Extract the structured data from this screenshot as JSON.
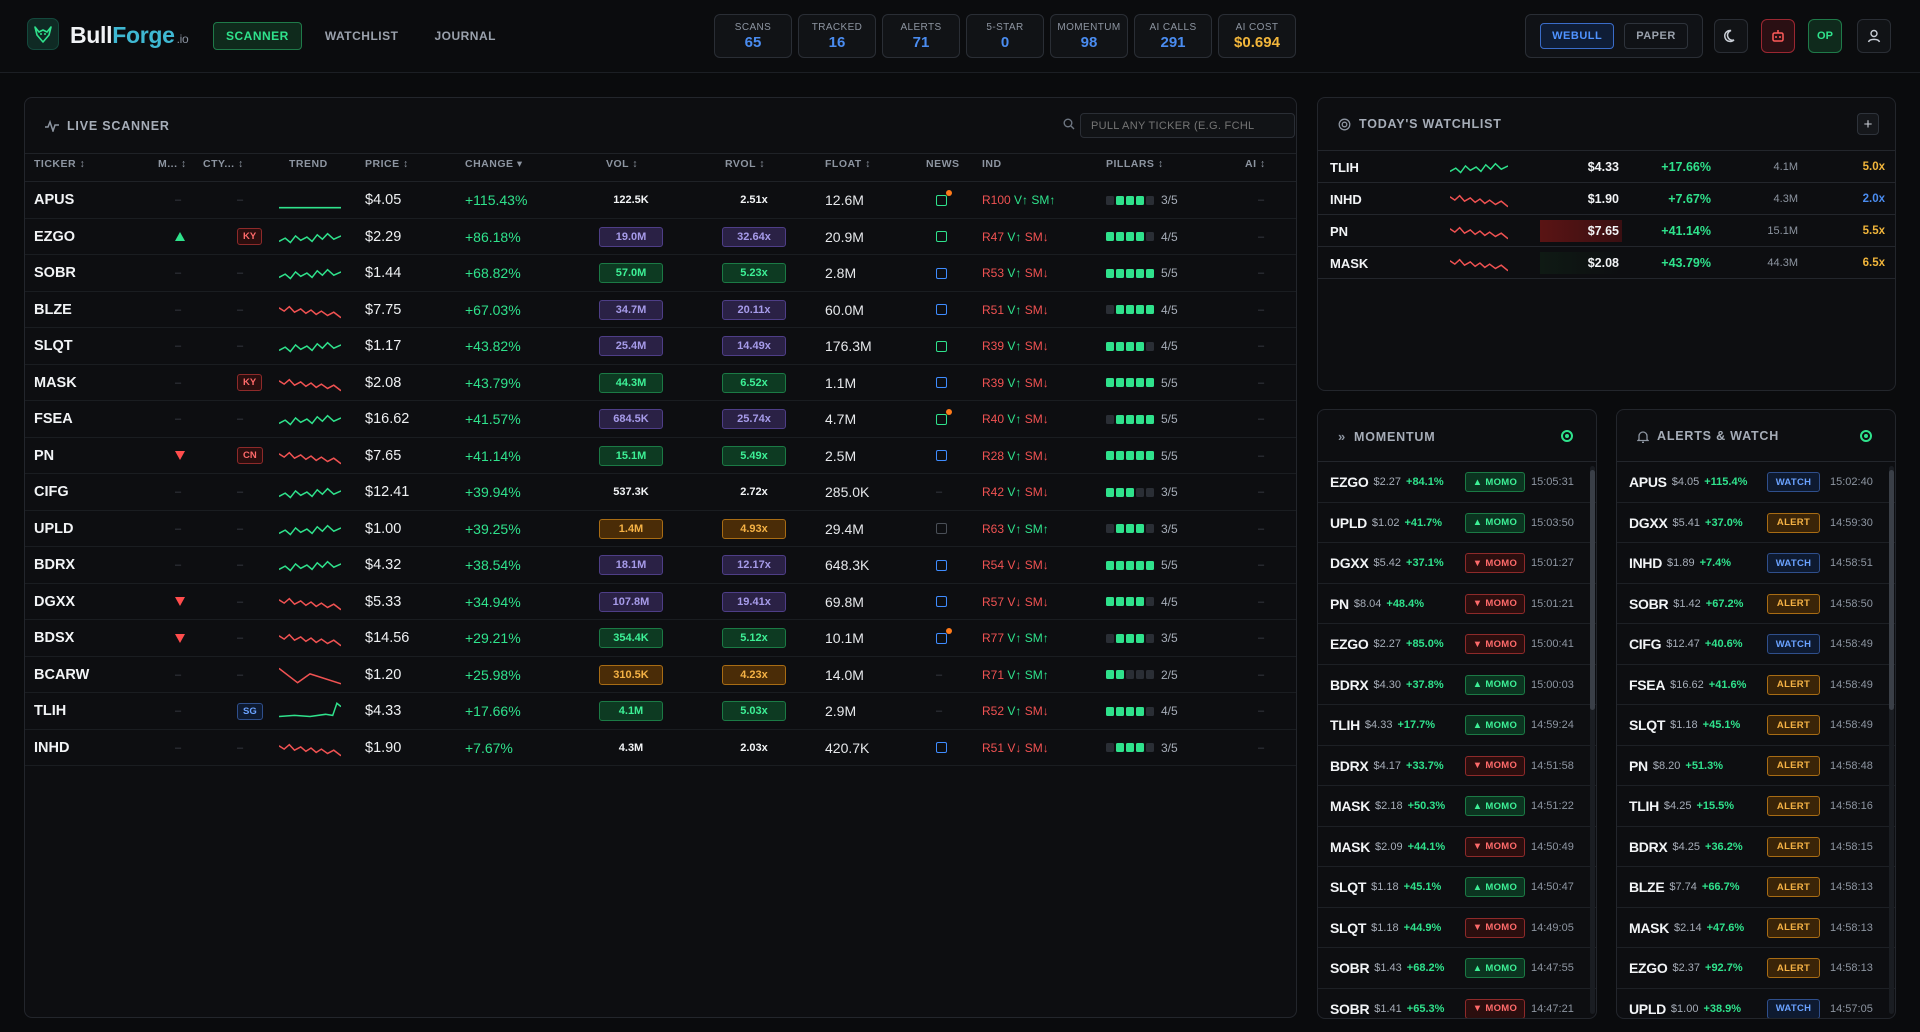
{
  "brand": {
    "name_a": "Bull",
    "name_b": "Forge",
    "name_c": ".io"
  },
  "nav": [
    {
      "label": "SCANNER",
      "active": true
    },
    {
      "label": "WATCHLIST",
      "active": false
    },
    {
      "label": "JOURNAL",
      "active": false
    }
  ],
  "stats": [
    {
      "label": "SCANS",
      "value": "65"
    },
    {
      "label": "TRACKED",
      "value": "16"
    },
    {
      "label": "ALERTS",
      "value": "71"
    },
    {
      "label": "5-STAR",
      "value": "0"
    },
    {
      "label": "MOMENTUM",
      "value": "98"
    },
    {
      "label": "AI CALLS",
      "value": "291"
    },
    {
      "label": "AI COST",
      "value": "$0.694"
    }
  ],
  "broker": {
    "webull": "WEBULL",
    "paper": "PAPER"
  },
  "header_icons": {
    "op_label": "OP"
  },
  "colors": {
    "green": "#2fe28c",
    "red": "#f05252",
    "blue": "#4a8cf0",
    "gold": "#f2b63b",
    "purple": "#a69be9",
    "orange": "#f5b245"
  },
  "scanner": {
    "title": "LIVE SCANNER",
    "search_placeholder": "PULL ANY TICKER (E.G. FCHL",
    "columns": {
      "ticker": "TICKER ↕",
      "m": "M... ↕",
      "cty": "CTY... ↕",
      "trend": "TREND",
      "price": "PRICE ↕",
      "change": "CHANGE ▾",
      "vol": "VOL ↕",
      "rvol": "RVOL ↕",
      "float": "FLOAT ↕",
      "news": "NEWS",
      "ind": "IND",
      "pillars": "PILLARS ↕",
      "ai": "AI ↕"
    },
    "rows": [
      {
        "ticker": "APUS",
        "m": "",
        "cty": "",
        "price": "$4.05",
        "change": "+115.43%",
        "vol": "122.5K",
        "vol_style": "plain",
        "rvol": "2.51x",
        "rvol_style": "plain",
        "float": "12.6M",
        "news": "green-hot",
        "ind_r": "R100",
        "ind_v": "V↑",
        "ind_sm": "SM↑",
        "pillars": 3,
        "trend_dir": "flat"
      },
      {
        "ticker": "EZGO",
        "m": "up",
        "cty": "KY",
        "price": "$2.29",
        "change": "+86.18%",
        "vol": "19.0M",
        "vol_style": "purple",
        "rvol": "32.64x",
        "rvol_style": "purple",
        "float": "20.9M",
        "news": "green",
        "ind_r": "R47",
        "ind_v": "V↑",
        "ind_sm": "SM↓",
        "pillars": 4,
        "trend_dir": "green"
      },
      {
        "ticker": "SOBR",
        "m": "",
        "cty": "",
        "price": "$1.44",
        "change": "+68.82%",
        "vol": "57.0M",
        "vol_style": "green",
        "rvol": "5.23x",
        "rvol_style": "green",
        "float": "2.8M",
        "news": "blue",
        "ind_r": "R53",
        "ind_v": "V↑",
        "ind_sm": "SM↓",
        "pillars": 5,
        "trend_dir": "green"
      },
      {
        "ticker": "BLZE",
        "m": "",
        "cty": "",
        "price": "$7.75",
        "change": "+67.03%",
        "vol": "34.7M",
        "vol_style": "purple",
        "rvol": "20.11x",
        "rvol_style": "purple",
        "float": "60.0M",
        "news": "blue",
        "ind_r": "R51",
        "ind_v": "V↑",
        "ind_sm": "SM↓",
        "pillars": 4,
        "trend_dir": "red"
      },
      {
        "ticker": "SLQT",
        "m": "",
        "cty": "",
        "price": "$1.17",
        "change": "+43.82%",
        "vol": "25.4M",
        "vol_style": "purple",
        "rvol": "14.49x",
        "rvol_style": "purple",
        "float": "176.3M",
        "news": "green",
        "ind_r": "R39",
        "ind_v": "V↑",
        "ind_sm": "SM↓",
        "pillars": 4,
        "trend_dir": "green"
      },
      {
        "ticker": "MASK",
        "m": "",
        "cty": "KY",
        "price": "$2.08",
        "change": "+43.79%",
        "vol": "44.3M",
        "vol_style": "green",
        "rvol": "6.52x",
        "rvol_style": "green",
        "float": "1.1M",
        "news": "blue",
        "ind_r": "R39",
        "ind_v": "V↑",
        "ind_sm": "SM↓",
        "pillars": 5,
        "trend_dir": "red"
      },
      {
        "ticker": "FSEA",
        "m": "",
        "cty": "",
        "price": "$16.62",
        "change": "+41.57%",
        "vol": "684.5K",
        "vol_style": "purple",
        "rvol": "25.74x",
        "rvol_style": "purple",
        "float": "4.7M",
        "news": "green-hot",
        "ind_r": "R40",
        "ind_v": "V↑",
        "ind_sm": "SM↓",
        "pillars": 5,
        "trend_dir": "green"
      },
      {
        "ticker": "PN",
        "m": "down",
        "cty": "CN",
        "price": "$7.65",
        "change": "+41.14%",
        "vol": "15.1M",
        "vol_style": "green",
        "rvol": "5.49x",
        "rvol_style": "green",
        "float": "2.5M",
        "news": "blue",
        "ind_r": "R28",
        "ind_v": "V↑",
        "ind_sm": "SM↓",
        "pillars": 5,
        "trend_dir": "red"
      },
      {
        "ticker": "CIFG",
        "m": "",
        "cty": "",
        "price": "$12.41",
        "change": "+39.94%",
        "vol": "537.3K",
        "vol_style": "plain",
        "rvol": "2.72x",
        "rvol_style": "plain",
        "float": "285.0K",
        "news": "none",
        "ind_r": "R42",
        "ind_v": "V↑",
        "ind_sm": "SM↓",
        "pillars": 3,
        "trend_dir": "green"
      },
      {
        "ticker": "UPLD",
        "m": "",
        "cty": "",
        "price": "$1.00",
        "change": "+39.25%",
        "vol": "1.4M",
        "vol_style": "orange",
        "rvol": "4.93x",
        "rvol_style": "orange",
        "float": "29.4M",
        "news": "grey",
        "ind_r": "R63",
        "ind_v": "V↑",
        "ind_sm": "SM↑",
        "pillars": 3,
        "trend_dir": "green"
      },
      {
        "ticker": "BDRX",
        "m": "",
        "cty": "",
        "price": "$4.32",
        "change": "+38.54%",
        "vol": "18.1M",
        "vol_style": "purple",
        "rvol": "12.17x",
        "rvol_style": "purple",
        "float": "648.3K",
        "news": "blue",
        "ind_r": "R54",
        "ind_v": "V↓",
        "ind_sm": "SM↓",
        "pillars": 5,
        "trend_dir": "green"
      },
      {
        "ticker": "DGXX",
        "m": "down",
        "cty": "",
        "price": "$5.33",
        "change": "+34.94%",
        "vol": "107.8M",
        "vol_style": "purple",
        "rvol": "19.41x",
        "rvol_style": "purple",
        "float": "69.8M",
        "news": "blue",
        "ind_r": "R57",
        "ind_v": "V↓",
        "ind_sm": "SM↓",
        "pillars": 4,
        "trend_dir": "red"
      },
      {
        "ticker": "BDSX",
        "m": "down",
        "cty": "",
        "price": "$14.56",
        "change": "+29.21%",
        "vol": "354.4K",
        "vol_style": "green",
        "rvol": "5.12x",
        "rvol_style": "green",
        "float": "10.1M",
        "news": "blue-hot",
        "ind_r": "R77",
        "ind_v": "V↑",
        "ind_sm": "SM↑",
        "pillars": 3,
        "trend_dir": "red"
      },
      {
        "ticker": "BCARW",
        "m": "",
        "cty": "",
        "price": "$1.20",
        "change": "+25.98%",
        "vol": "310.5K",
        "vol_style": "orange",
        "rvol": "4.23x",
        "rvol_style": "orange",
        "float": "14.0M",
        "news": "none",
        "ind_r": "R71",
        "ind_v": "V↑",
        "ind_sm": "SM↑",
        "pillars": 2,
        "trend_dir": "red-v"
      },
      {
        "ticker": "TLIH",
        "m": "",
        "cty": "SG",
        "price": "$4.33",
        "change": "+17.66%",
        "vol": "4.1M",
        "vol_style": "green",
        "rvol": "5.03x",
        "rvol_style": "green",
        "float": "2.9M",
        "news": "none",
        "ind_r": "R52",
        "ind_v": "V↑",
        "ind_sm": "SM↓",
        "pillars": 4,
        "trend_dir": "green-spike"
      },
      {
        "ticker": "INHD",
        "m": "",
        "cty": "",
        "price": "$1.90",
        "change": "+7.67%",
        "vol": "4.3M",
        "vol_style": "plain",
        "rvol": "2.03x",
        "rvol_style": "plain",
        "float": "420.7K",
        "news": "blue",
        "ind_r": "R51",
        "ind_v": "V↓",
        "ind_sm": "SM↓",
        "pillars": 3,
        "trend_dir": "red"
      }
    ]
  },
  "watchlist": {
    "title": "TODAY'S WATCHLIST",
    "add_label": "+",
    "rows": [
      {
        "ticker": "TLIH",
        "price": "$4.33",
        "change": "+17.66%",
        "vol": "4.1M",
        "rvol": "5.0x",
        "rvol_color": "#f2b63b",
        "spark": "green"
      },
      {
        "ticker": "INHD",
        "price": "$1.90",
        "change": "+7.67%",
        "vol": "4.3M",
        "rvol": "2.0x",
        "rvol_color": "#4a8cf0",
        "spark": "red"
      },
      {
        "ticker": "PN",
        "price": "$7.65",
        "change": "+41.14%",
        "vol": "15.1M",
        "rvol": "5.5x",
        "rvol_color": "#f2b63b",
        "spark": "red"
      },
      {
        "ticker": "MASK",
        "price": "$2.08",
        "change": "+43.79%",
        "vol": "44.3M",
        "rvol": "6.5x",
        "rvol_color": "#f2b63b",
        "spark": "red"
      }
    ]
  },
  "momentum": {
    "title": "MOMENTUM",
    "rows": [
      {
        "ticker": "EZGO",
        "price": "$2.27",
        "change": "+84.1%",
        "dir": "up",
        "badge": "▲ MOMO",
        "time": "15:05:31"
      },
      {
        "ticker": "UPLD",
        "price": "$1.02",
        "change": "+41.7%",
        "dir": "up",
        "badge": "▲ MOMO",
        "time": "15:03:50"
      },
      {
        "ticker": "DGXX",
        "price": "$5.42",
        "change": "+37.1%",
        "dir": "down",
        "badge": "▼ MOMO",
        "time": "15:01:27"
      },
      {
        "ticker": "PN",
        "price": "$8.04",
        "change": "+48.4%",
        "dir": "down",
        "badge": "▼ MOMO",
        "time": "15:01:21"
      },
      {
        "ticker": "EZGO",
        "price": "$2.27",
        "change": "+85.0%",
        "dir": "down",
        "badge": "▼ MOMO",
        "time": "15:00:41"
      },
      {
        "ticker": "BDRX",
        "price": "$4.30",
        "change": "+37.8%",
        "dir": "up",
        "badge": "▲ MOMO",
        "time": "15:00:03"
      },
      {
        "ticker": "TLIH",
        "price": "$4.33",
        "change": "+17.7%",
        "dir": "up",
        "badge": "▲ MOMO",
        "time": "14:59:24"
      },
      {
        "ticker": "BDRX",
        "price": "$4.17",
        "change": "+33.7%",
        "dir": "down",
        "badge": "▼ MOMO",
        "time": "14:51:58"
      },
      {
        "ticker": "MASK",
        "price": "$2.18",
        "change": "+50.3%",
        "dir": "up",
        "badge": "▲ MOMO",
        "time": "14:51:22"
      },
      {
        "ticker": "MASK",
        "price": "$2.09",
        "change": "+44.1%",
        "dir": "down",
        "badge": "▼ MOMO",
        "time": "14:50:49"
      },
      {
        "ticker": "SLQT",
        "price": "$1.18",
        "change": "+45.1%",
        "dir": "up",
        "badge": "▲ MOMO",
        "time": "14:50:47"
      },
      {
        "ticker": "SLQT",
        "price": "$1.18",
        "change": "+44.9%",
        "dir": "down",
        "badge": "▼ MOMO",
        "time": "14:49:05"
      },
      {
        "ticker": "SOBR",
        "price": "$1.43",
        "change": "+68.2%",
        "dir": "up",
        "badge": "▲ MOMO",
        "time": "14:47:55"
      },
      {
        "ticker": "SOBR",
        "price": "$1.41",
        "change": "+65.3%",
        "dir": "down",
        "badge": "▼ MOMO",
        "time": "14:47:21"
      }
    ]
  },
  "alerts": {
    "title": "ALERTS & WATCH",
    "rows": [
      {
        "ticker": "APUS",
        "price": "$4.05",
        "change": "+115.4%",
        "kind": "watch",
        "badge": "WATCH",
        "time": "15:02:40"
      },
      {
        "ticker": "DGXX",
        "price": "$5.41",
        "change": "+37.0%",
        "kind": "alert",
        "badge": "ALERT",
        "time": "14:59:30"
      },
      {
        "ticker": "INHD",
        "price": "$1.89",
        "change": "+7.4%",
        "kind": "watch",
        "badge": "WATCH",
        "time": "14:58:51"
      },
      {
        "ticker": "SOBR",
        "price": "$1.42",
        "change": "+67.2%",
        "kind": "alert",
        "badge": "ALERT",
        "time": "14:58:50"
      },
      {
        "ticker": "CIFG",
        "price": "$12.47",
        "change": "+40.6%",
        "kind": "watch",
        "badge": "WATCH",
        "time": "14:58:49"
      },
      {
        "ticker": "FSEA",
        "price": "$16.62",
        "change": "+41.6%",
        "kind": "alert",
        "badge": "ALERT",
        "time": "14:58:49"
      },
      {
        "ticker": "SLQT",
        "price": "$1.18",
        "change": "+45.1%",
        "kind": "alert",
        "badge": "ALERT",
        "time": "14:58:49"
      },
      {
        "ticker": "PN",
        "price": "$8.20",
        "change": "+51.3%",
        "kind": "alert",
        "badge": "ALERT",
        "time": "14:58:48"
      },
      {
        "ticker": "TLIH",
        "price": "$4.25",
        "change": "+15.5%",
        "kind": "alert",
        "badge": "ALERT",
        "time": "14:58:16"
      },
      {
        "ticker": "BDRX",
        "price": "$4.25",
        "change": "+36.2%",
        "kind": "alert",
        "badge": "ALERT",
        "time": "14:58:15"
      },
      {
        "ticker": "BLZE",
        "price": "$7.74",
        "change": "+66.7%",
        "kind": "alert",
        "badge": "ALERT",
        "time": "14:58:13"
      },
      {
        "ticker": "MASK",
        "price": "$2.14",
        "change": "+47.6%",
        "kind": "alert",
        "badge": "ALERT",
        "time": "14:58:13"
      },
      {
        "ticker": "EZGO",
        "price": "$2.37",
        "change": "+92.7%",
        "kind": "alert",
        "badge": "ALERT",
        "time": "14:58:13"
      },
      {
        "ticker": "UPLD",
        "price": "$1.00",
        "change": "+38.9%",
        "kind": "watch",
        "badge": "WATCH",
        "time": "14:57:05"
      }
    ]
  }
}
